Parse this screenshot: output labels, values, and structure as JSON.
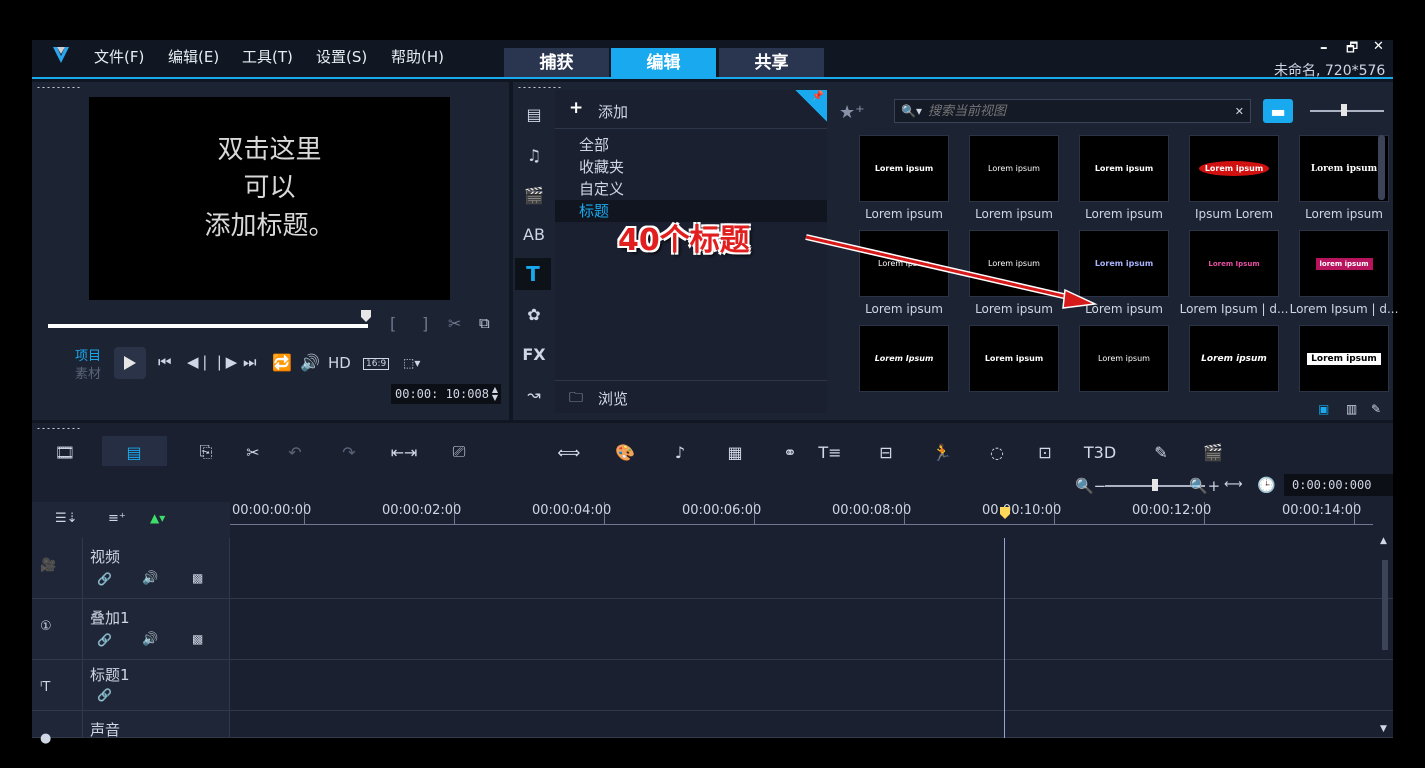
{
  "menu": {
    "file": "文件(F)",
    "edit": "编辑(E)",
    "tools": "工具(T)",
    "settings": "设置(S)",
    "help": "帮助(H)"
  },
  "tabs": {
    "capture": "捕获",
    "edit": "编辑",
    "share": "共享"
  },
  "window": {
    "minimize": "–",
    "restore": "🗗",
    "close": "✕",
    "project_info": "未命名, 720*576"
  },
  "preview": {
    "text_line1": "双击这里",
    "text_line2": "可以",
    "text_line3": "添加标题。",
    "mode_project": "项目",
    "mode_clip": "素材",
    "hd": "HD",
    "aspect": "16:9",
    "timecode": "00:00: 10:008",
    "playhead_fraction": 0.995
  },
  "library": {
    "add_label": "添加",
    "browse_label": "浏览",
    "categories": [
      "全部",
      "收藏夹",
      "自定义",
      "标题"
    ],
    "selected_category": "标题",
    "search_placeholder": "搜索当前视图",
    "annotation": "40个标题",
    "thumbnails": [
      {
        "preview": "Lorem ipsum",
        "label": "Lorem ipsum"
      },
      {
        "preview": "Lorem ipsum",
        "label": "Lorem ipsum"
      },
      {
        "preview": "Lorem ipsum",
        "label": "Lorem ipsum"
      },
      {
        "preview": "Lorem ipsum",
        "label": "Ipsum Lorem"
      },
      {
        "preview": "Lorem ipsum",
        "label": "Lorem ipsum"
      },
      {
        "preview": "Lorem ipsum",
        "label": "Lorem ipsum"
      },
      {
        "preview": "Lorem ipsum",
        "label": "Lorem ipsum"
      },
      {
        "preview": "Lorem ipsum",
        "label": "Lorem ipsum"
      },
      {
        "preview": "Lorem Ipsum",
        "label": "Lorem Ipsum | d..."
      },
      {
        "preview": "lorem ipsum",
        "label": "Lorem Ipsum | d..."
      },
      {
        "preview": "Lorem Ipsum",
        "label": ""
      },
      {
        "preview": "Lorem ipsum",
        "label": ""
      },
      {
        "preview": "Lorem ipsum",
        "label": ""
      },
      {
        "preview": "Lorem ipsum",
        "label": ""
      },
      {
        "preview": "Lorem ipsum",
        "label": ""
      }
    ]
  },
  "timeline": {
    "timecode": "0:00:00:000",
    "ruler": [
      "00:00:00:00",
      "00:00:02:00",
      "00:00:04:00",
      "00:00:06:00",
      "00:00:08:00",
      "00:00:10:00",
      "00:00:12:00",
      "00:00:14:00"
    ],
    "tracks": [
      {
        "name": "视频"
      },
      {
        "name": "叠加1"
      },
      {
        "name": "标题1"
      },
      {
        "name": "声音"
      }
    ]
  },
  "colors": {
    "accent": "#19a9ee",
    "panel": "#1c2333",
    "background": "#111722"
  }
}
